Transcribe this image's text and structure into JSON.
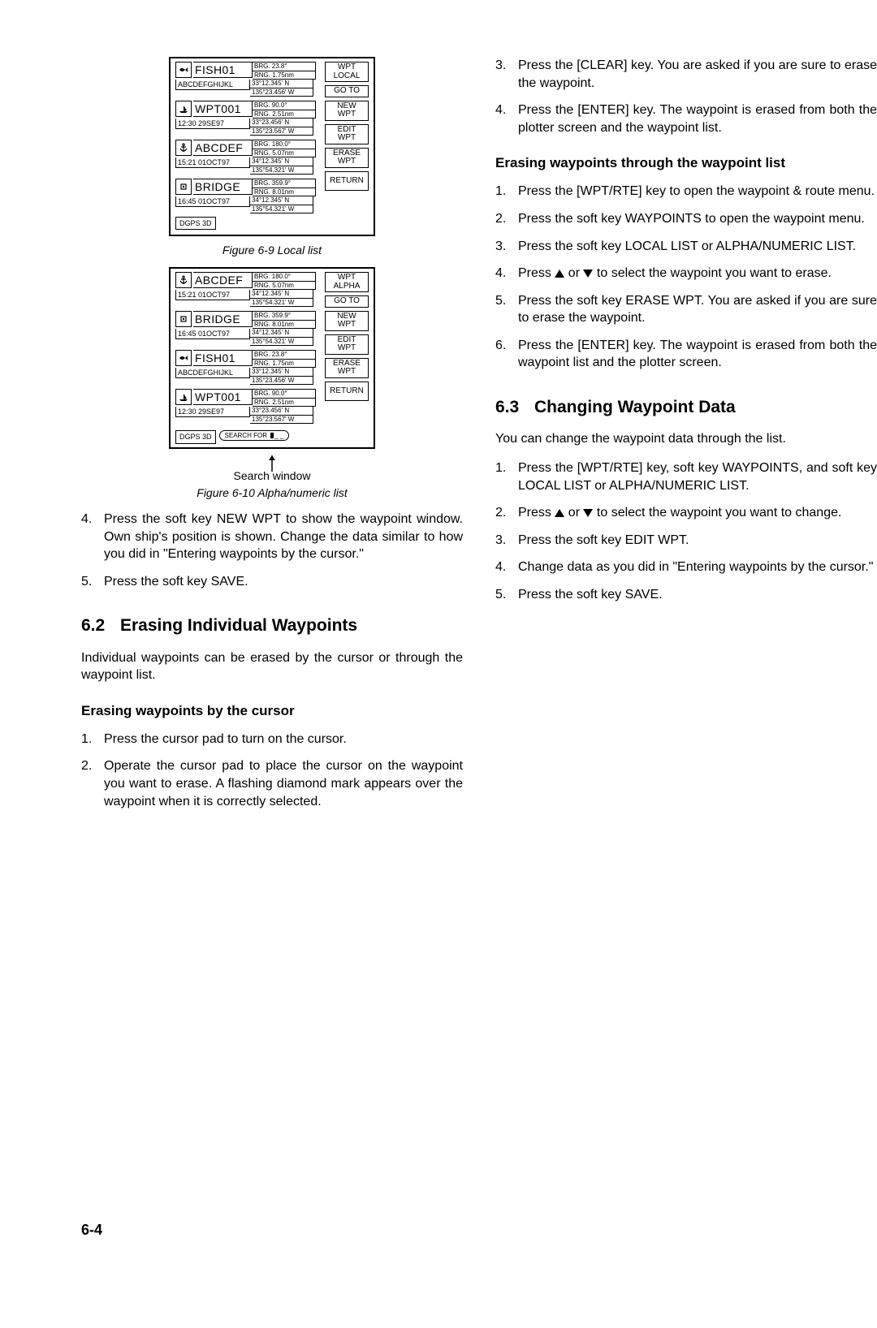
{
  "figures": {
    "local": {
      "caption": "Figure 6-9 Local list",
      "softkeys": [
        "WPT\nLOCAL",
        "GO TO",
        "NEW\nWPT",
        "EDIT\nWPT",
        "ERASE\nWPT",
        "RETURN"
      ],
      "status": "DGPS 3D",
      "entries": [
        {
          "icon": "fish-icon",
          "name": "FISH01",
          "brg": "BRG.    23.8°",
          "rng": "RNG.  1.75nm",
          "lat": "33°12.345' N",
          "lon": "135°23.456' W",
          "sub": "ABCDEFGHIJKL"
        },
        {
          "icon": "boat-icon",
          "name": "WPT001",
          "brg": "BRG.    90.0°",
          "rng": "RNG.  2.51nm",
          "lat": "33°23.456' N",
          "lon": "135°23.567' W",
          "sub": "12:30 29SE97"
        },
        {
          "icon": "anchor-icon",
          "name": "ABCDEF",
          "brg": "BRG.   180.0°",
          "rng": "RNG.  5.07nm",
          "lat": "34°12.345' N",
          "lon": "135°54.321' W",
          "sub": "15:21 01OCT97"
        },
        {
          "icon": "square-icon",
          "name": "BRIDGE",
          "brg": "BRG.  359.9°",
          "rng": "RNG.  8.01nm",
          "lat": "34°12.345' N",
          "lon": "135°54.321' W",
          "sub": "16:45 01OCT97"
        }
      ]
    },
    "alpha": {
      "caption": "Figure 6-10 Alpha/numeric list",
      "softkeys": [
        "WPT\nALPHA",
        "GO TO",
        "NEW\nWPT",
        "EDIT\nWPT",
        "ERASE\nWPT",
        "RETURN"
      ],
      "status": "DGPS 3D",
      "entries": [
        {
          "icon": "anchor-icon",
          "name": "ABCDEF",
          "brg": "BRG.   180.0°",
          "rng": "RNG.  5.07nm",
          "lat": "34°12.345' N",
          "lon": "135°54.321' W",
          "sub": "15:21 01OCT97"
        },
        {
          "icon": "square-icon",
          "name": "BRIDGE",
          "brg": "BRG.  359.9°",
          "rng": "RNG.  8.01nm",
          "lat": "34°12.345' N",
          "lon": "135°54.321' W",
          "sub": "16:45 01OCT97"
        },
        {
          "icon": "fish-icon",
          "name": "FISH01",
          "brg": "BRG.    23.8°",
          "rng": "RNG.  1.75nm",
          "lat": "33°12.345' N",
          "lon": "135°23.456' W",
          "sub": "ABCDEFGHIJKL"
        },
        {
          "icon": "boat-icon",
          "name": "WPT001",
          "brg": "BRG.    90.0°",
          "rng": "RNG.  2.51nm",
          "lat": "33°23.456' N",
          "lon": "135°23.567' W",
          "sub": "12:30 29SE97"
        }
      ],
      "search_label_short": "SEARCH FOR",
      "underscores": "_ _",
      "arrow_label": "Search window"
    }
  },
  "left": {
    "steps_a": [
      "Press the soft key NEW WPT to show the waypoint window. Own ship's position is shown. Change the data similar to how you did in \"Entering waypoints by the cursor.\"",
      "Press the soft key SAVE."
    ],
    "sec62_num": "6.2",
    "sec62_title": "Erasing Individual Waypoints",
    "sec62_intro": "Individual waypoints can be erased by the cursor or through the waypoint list.",
    "sub_cursor_title": "Erasing waypoints by the cursor",
    "cursor_steps": [
      "Press the cursor pad to turn on the cursor.",
      "Operate the cursor pad to place the cursor on the waypoint you want to erase. A flashing diamond mark appears over the waypoint when it is correctly selected."
    ]
  },
  "right": {
    "cursor_steps_cont": [
      "Press the [CLEAR] key. You are asked if you are sure to erase the waypoint.",
      "Press the [ENTER] key. The waypoint is erased from both the plotter screen and the waypoint list."
    ],
    "sub_list_title": "Erasing waypoints through the waypoint list",
    "list_steps": [
      "Press the [WPT/RTE] key to open the waypoint & route menu.",
      "Press the soft key WAYPOINTS to open the waypoint menu.",
      "Press the soft key LOCAL LIST or ALPHA/NUMERIC LIST.",
      "Press __UP__ or __DOWN__ to select the waypoint you want to erase.",
      "Press the soft key ERASE WPT. You are asked if you are sure to erase the waypoint.",
      "Press the [ENTER] key. The waypoint is erased from both the waypoint list and the plotter screen."
    ],
    "sec63_num": "6.3",
    "sec63_title": "Changing Waypoint Data",
    "sec63_intro": "You can change the waypoint data through the list.",
    "sec63_steps": [
      "Press the [WPT/RTE] key, soft key WAYPOINTS, and soft key LOCAL LIST or ALPHA/NUMERIC LIST.",
      "Press __UP__ or __DOWN__ to select the waypoint you want to change.",
      "Press the soft key EDIT WPT.",
      "Change data as you did in \"Entering waypoints by the cursor.\"",
      "Press the soft key SAVE."
    ]
  },
  "page_number": "6-4"
}
